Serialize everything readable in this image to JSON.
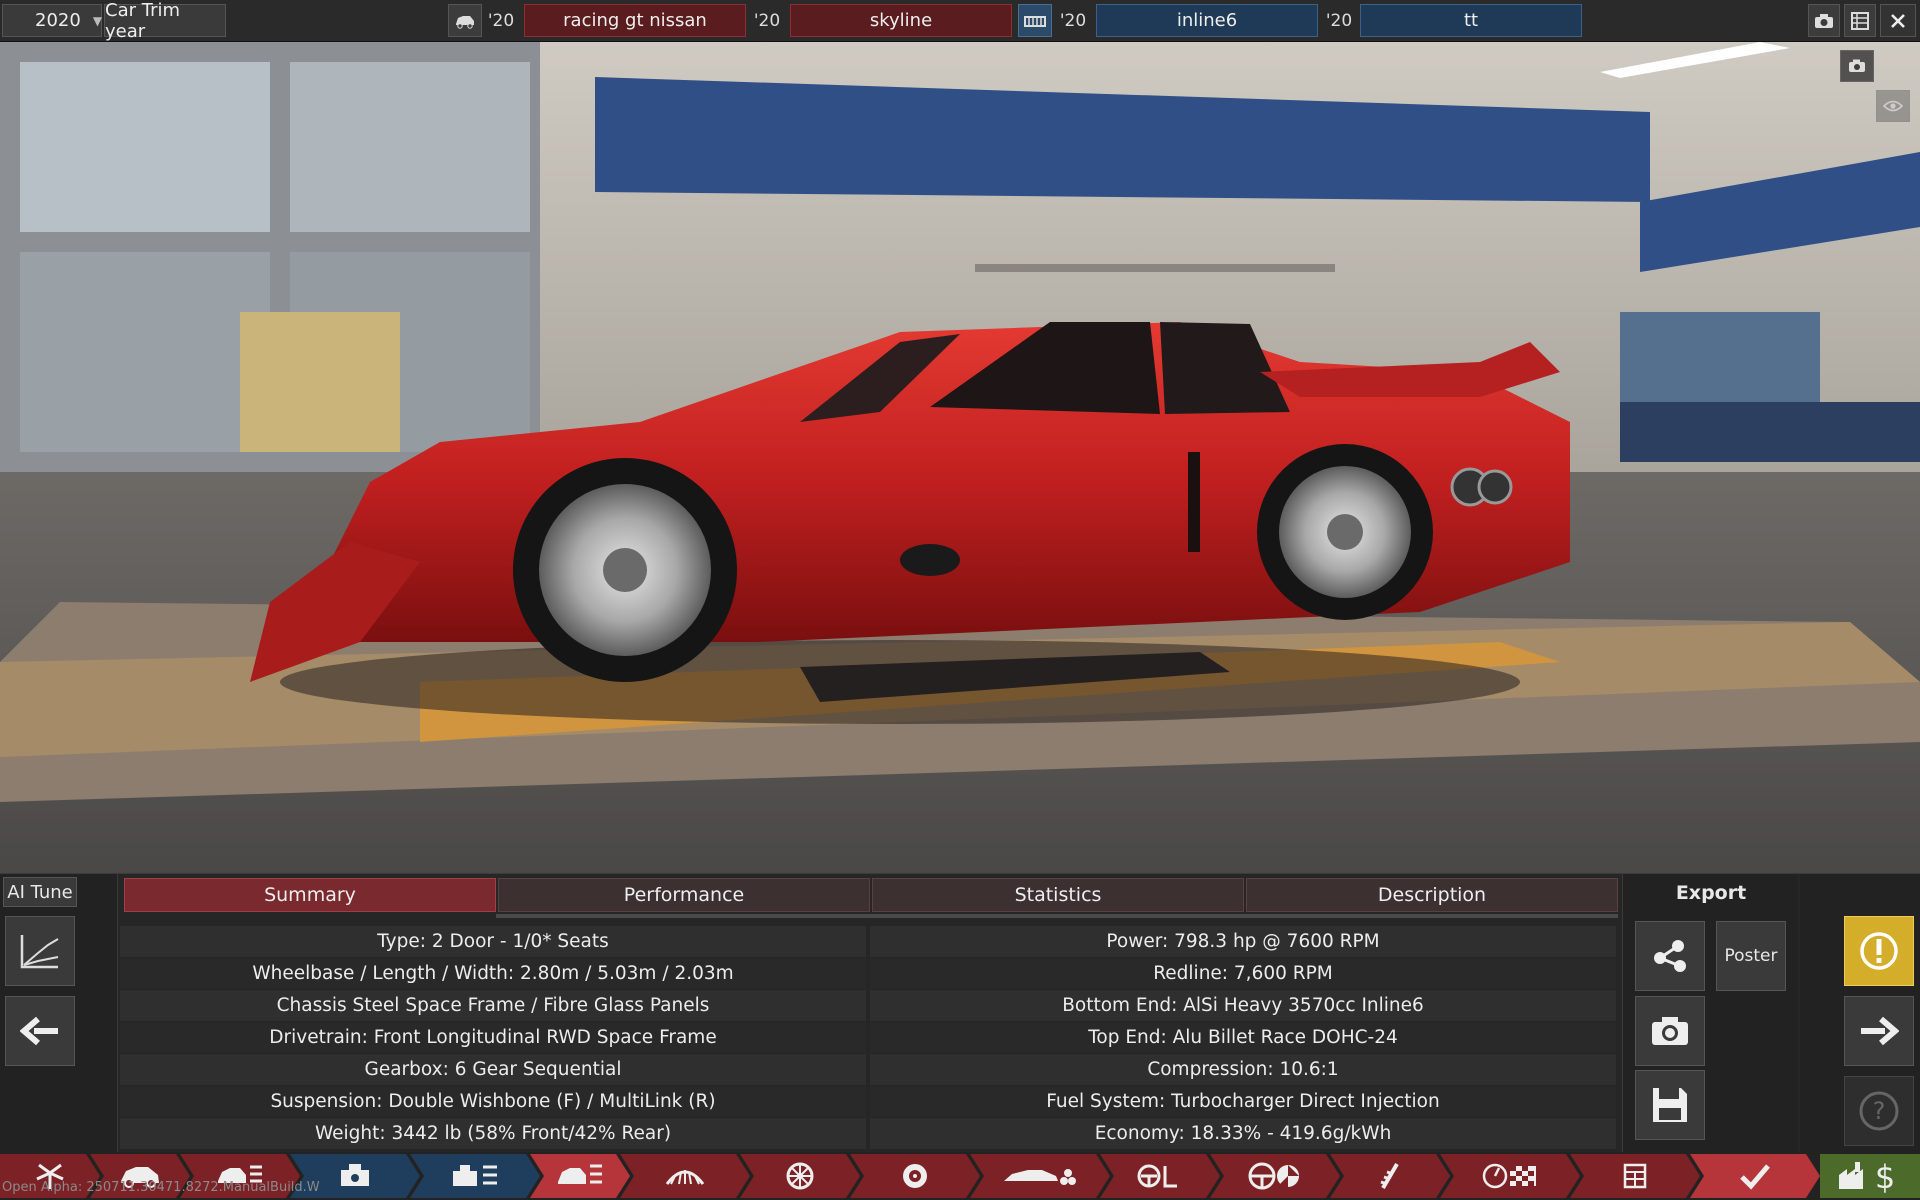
{
  "topbar": {
    "trim_year": "2020",
    "trim_year_label": "Car Trim year",
    "model_year_prefix": "'20",
    "model_family": "racing gt nissan",
    "trim_year_prefix": "'20",
    "trim_name": "skyline",
    "engine_family_year_prefix": "'20",
    "engine_family": "inline6",
    "engine_variant_year_prefix": "'20",
    "engine_variant": "tt"
  },
  "panel": {
    "ai_tune": "AI Tune",
    "tabs": [
      "Summary",
      "Performance",
      "Statistics",
      "Description"
    ],
    "active_tab": "Summary",
    "summary_left": [
      "Type: 2 Door - 1/0* Seats",
      "Wheelbase / Length / Width: 2.80m / 5.03m / 2.03m",
      "Chassis Steel Space Frame / Fibre Glass Panels",
      "Drivetrain: Front Longitudinal RWD Space Frame",
      "Gearbox: 6 Gear Sequential",
      "Suspension: Double Wishbone (F) / MultiLink (R)",
      "Weight: 3442 lb (58% Front/42% Rear)"
    ],
    "summary_right": [
      "Power: 798.3 hp @ 7600 RPM",
      "Redline:  7,600 RPM",
      "Bottom End: AlSi Heavy 3570cc Inline6",
      "Top End: Alu Billet Race DOHC-24",
      "Compression: 10.6:1",
      "Fuel System: Turbocharger Direct Injection",
      "Economy: 18.33% - 419.6g/kWh"
    ],
    "export_title": "Export",
    "poster_label": "Poster"
  },
  "build_label": "Open Alpha: 250711.30471.8272.ManualBuild.W",
  "colors": {
    "accent_red": "#7a2a2e",
    "accent_blue": "#1f3a57",
    "warning_yellow": "#d4ae2a",
    "car_paint": "#c01f1f"
  }
}
